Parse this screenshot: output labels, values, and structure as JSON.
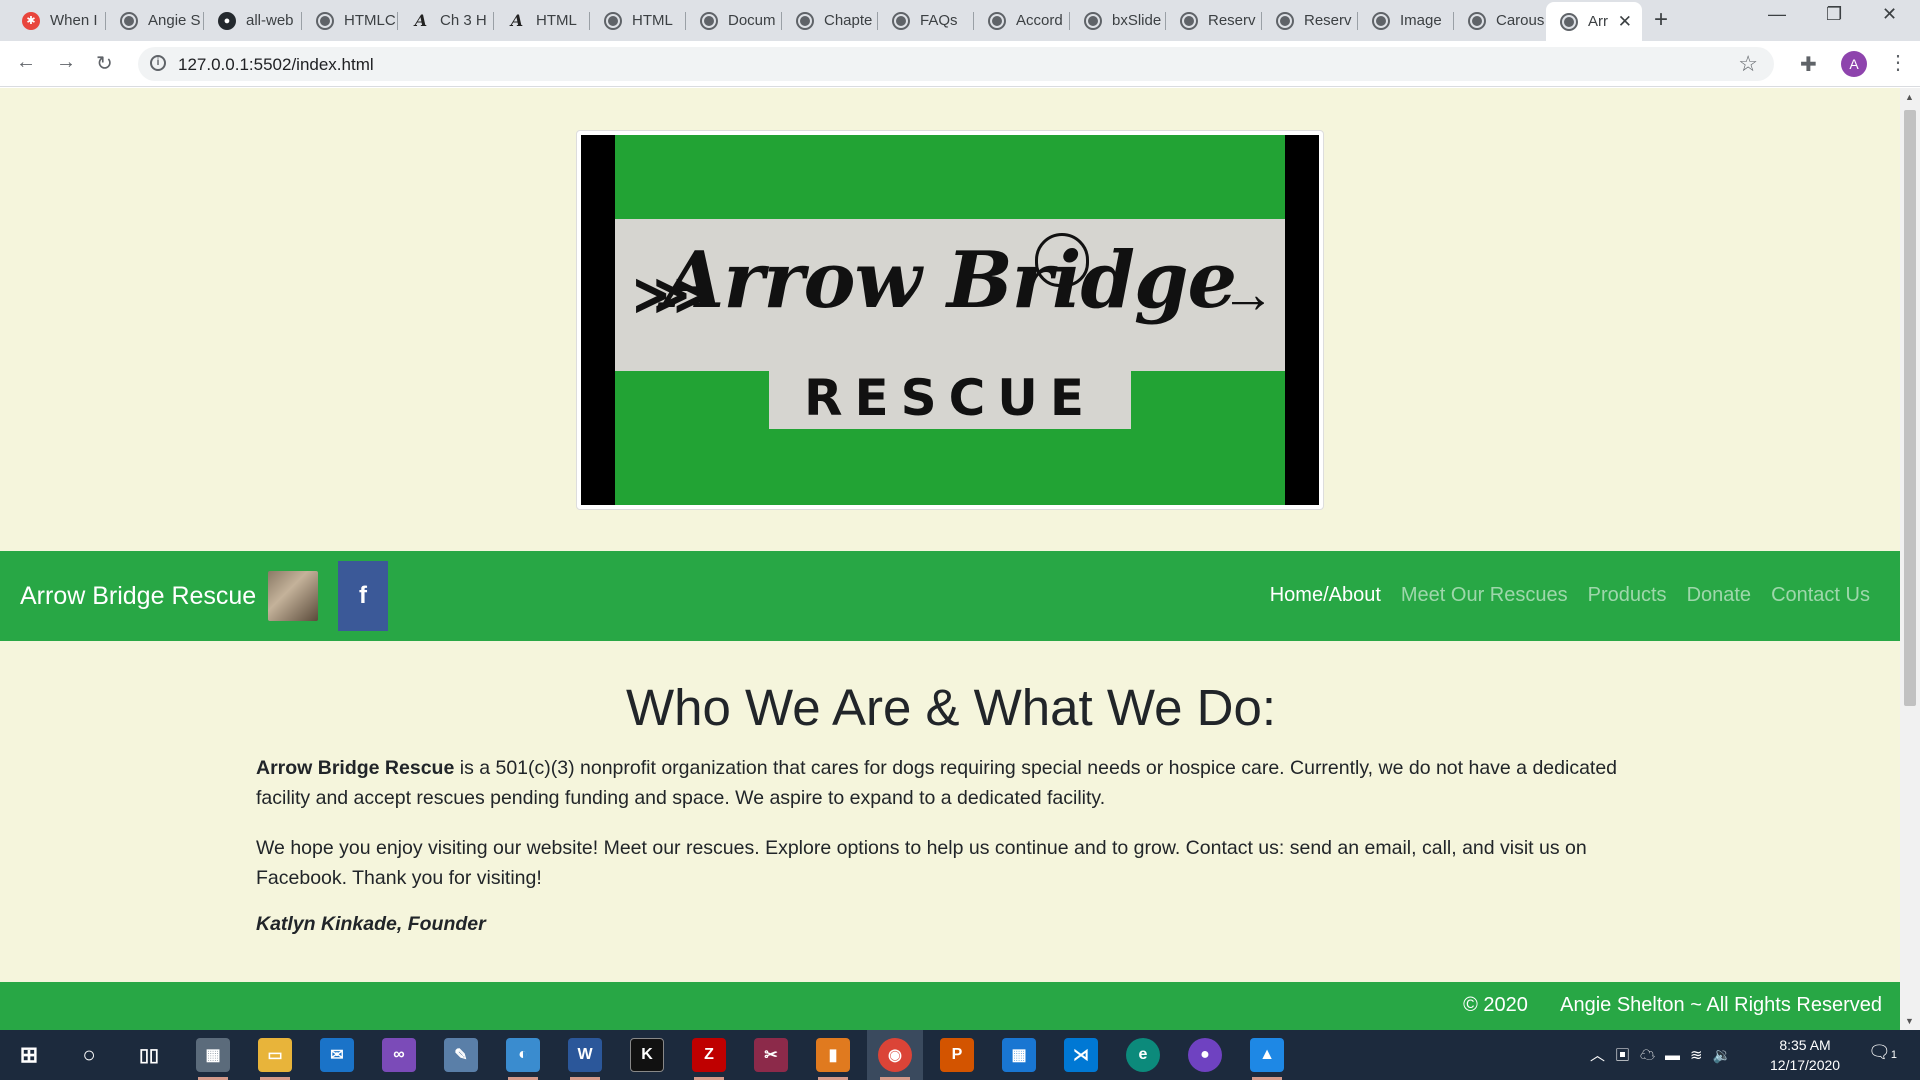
{
  "browser": {
    "tabs": [
      {
        "label": "When I",
        "icon": "when-icon"
      },
      {
        "label": "Angie S",
        "icon": "globe-icon"
      },
      {
        "label": "all-web",
        "icon": "github-icon"
      },
      {
        "label": "HTMLC",
        "icon": "globe-icon"
      },
      {
        "label": "Ch 3 H",
        "icon": "acrobat-icon"
      },
      {
        "label": "HTML",
        "icon": "acrobat-icon"
      },
      {
        "label": "HTML",
        "icon": "globe-icon"
      },
      {
        "label": "Docum",
        "icon": "globe-icon"
      },
      {
        "label": "Chapte",
        "icon": "globe-icon"
      },
      {
        "label": "FAQs",
        "icon": "globe-icon"
      },
      {
        "label": "Accord",
        "icon": "globe-icon"
      },
      {
        "label": "bxSlide",
        "icon": "globe-icon"
      },
      {
        "label": "Reserv",
        "icon": "globe-icon"
      },
      {
        "label": "Reserv",
        "icon": "globe-icon"
      },
      {
        "label": "Image",
        "icon": "globe-icon"
      },
      {
        "label": "Carous",
        "icon": "globe-icon"
      },
      {
        "label": "Arr",
        "icon": "globe-icon",
        "active": true
      }
    ],
    "url": "127.0.0.1:5502/index.html",
    "profile_initial": "A"
  },
  "logo": {
    "script_text": "Arrow Bridge",
    "rescue_text": "RESCUE",
    "colors": {
      "green": "#22a334",
      "band": "#d6d5d0",
      "sides": "#000000"
    }
  },
  "navbar": {
    "brand": "Arrow Bridge Rescue",
    "facebook_label": "f",
    "links": [
      {
        "label": "Home/About",
        "active": true
      },
      {
        "label": "Meet Our Rescues"
      },
      {
        "label": "Products"
      },
      {
        "label": "Donate"
      },
      {
        "label": "Contact Us"
      }
    ],
    "color": "#28a745"
  },
  "main": {
    "heading": "Who We Are & What We Do:",
    "intro_strong": "Arrow Bridge Rescue",
    "intro_rest": " is a 501(c)(3) nonprofit organization that cares for dogs requiring special needs or hospice care. Currently, we do not have a dedicated facility and accept rescues pending funding and space. We aspire to expand to a dedicated facility.",
    "paragraph2": "We hope you enjoy visiting our website! Meet our rescues. Explore options to help us continue and to grow. Contact us: send an email, call, and visit us on Facebook. Thank you for visiting!",
    "signature": "Katlyn Kinkade, Founder"
  },
  "footer": {
    "text": "© 2020      Angie Shelton ~ All Rights Reserved"
  },
  "taskbar": {
    "time": "8:35 AM",
    "date": "12/17/2020",
    "notification_count": "1"
  }
}
